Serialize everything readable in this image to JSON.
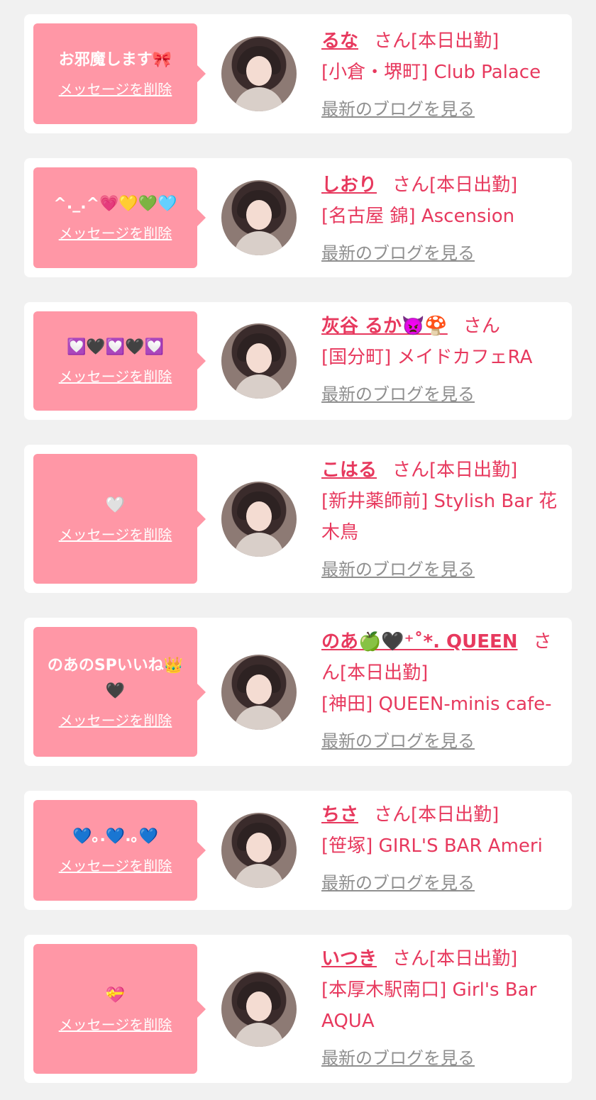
{
  "delete_label": "メッセージを削除",
  "blog_label": "最新のブログを見る",
  "honorific": "さん",
  "colors": {
    "accent": "#e7395e",
    "bubble": "#ff97a6",
    "link_gray": "#8f8f8f",
    "background": "#f1f1f1"
  },
  "entries": [
    {
      "message": "お邪魔します🎀",
      "name": "るな",
      "status": "[本日出勤]",
      "store": "[小倉・堺町] Club Palace"
    },
    {
      "message": "^._.^💗💛💚🩵",
      "name": "しおり",
      "status": "[本日出勤]",
      "store": "[名古屋 錦] Ascension"
    },
    {
      "message": "💟🖤💟🖤💟",
      "name": "灰谷 るか👿🍄",
      "status": "",
      "store": "[国分町] メイドカフェRA"
    },
    {
      "message": "🤍",
      "name": "こはる",
      "status": "[本日出勤]",
      "store": "[新井薬師前] Stylish Bar 花木鳥"
    },
    {
      "message": "のあのSPいいね👑🖤",
      "name": "のあ🍏🖤⁺˚*. QUEEN",
      "status": "[本日出勤]",
      "store": "[神田] QUEEN-minis cafe-"
    },
    {
      "message": "💙｡.💙.｡💙",
      "name": "ちさ",
      "status": "[本日出勤]",
      "store": "[笹塚] GIRL'S BAR Ameri"
    },
    {
      "message": "💝",
      "name": "いつき",
      "status": "[本日出勤]",
      "store": "[本厚木駅南口] Girl's Bar AQUA"
    }
  ]
}
